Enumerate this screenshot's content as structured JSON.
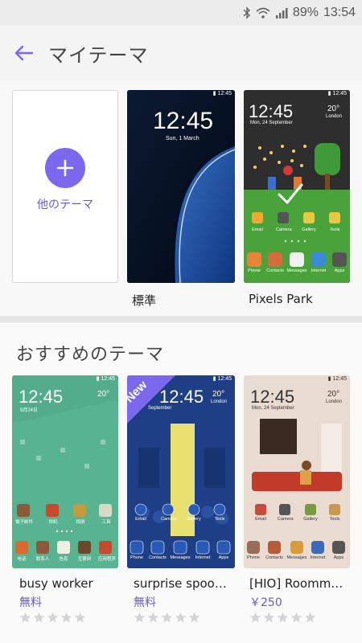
{
  "status_bar": {
    "battery": "89%",
    "time": "13:54",
    "icons": [
      "bluetooth-icon",
      "wifi-icon",
      "signal-icon"
    ]
  },
  "header": {
    "title": "マイテーマ"
  },
  "my_themes": {
    "add_label": "他のテーマ",
    "items": [
      {
        "name": "標準",
        "preview_time": "12:45",
        "preview_date": "Sun, 1 March"
      },
      {
        "name": "Pixels Park",
        "preview_time": "12:45",
        "preview_date": "Mon, 24 September",
        "preview_weather": "20°",
        "preview_city": "London",
        "apps_row1": [
          "Email",
          "Camera",
          "Gallery",
          "Tools"
        ],
        "apps_row2": [
          "Phone",
          "Contacts",
          "Messages",
          "Internet",
          "Apps"
        ]
      }
    ]
  },
  "recommended": {
    "title": "おすすめのテーマ",
    "items": [
      {
        "name": "busy worker",
        "price": "無料",
        "preview_time": "12:45",
        "preview_date": "9月24日",
        "preview_weather": "20°",
        "apps_row1": [
          "電子邮件",
          "相机",
          "相册",
          "工具"
        ],
        "apps_row2": [
          "电话",
          "联系人",
          "信息",
          "互联网",
          "应用程序"
        ]
      },
      {
        "name": "surprise spoo…",
        "price": "無料",
        "badge": "New",
        "preview_time": "12:45",
        "preview_date": "September",
        "preview_weather": "20°",
        "preview_city": "London",
        "apps_row1": [
          "Email",
          "Camera",
          "Gallery",
          "Tools"
        ],
        "apps_row2": [
          "Phone",
          "Contacts",
          "Messages",
          "Internet",
          "Apps"
        ]
      },
      {
        "name": "[HIO] Roomm…",
        "price": "￥250",
        "preview_time": "12:45",
        "preview_date": "Mon, 24 September",
        "preview_weather": "20°",
        "preview_city": "London",
        "apps_row1": [
          "Email",
          "Camera",
          "Gallery",
          "Tools"
        ],
        "apps_row2": [
          "Phone",
          "Contacts",
          "Messages",
          "Internet",
          "Apps"
        ]
      }
    ]
  },
  "colors": {
    "accent": "#7b68ee",
    "price": "#6a5acd"
  }
}
